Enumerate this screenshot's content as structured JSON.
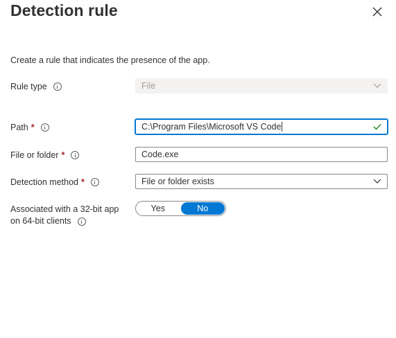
{
  "panel": {
    "title": "Detection rule",
    "description": "Create a rule that indicates the presence of the app."
  },
  "rule_type": {
    "label": "Rule type",
    "value": "File"
  },
  "path": {
    "label": "Path",
    "required_mark": "*",
    "value": "C:\\Program Files\\Microsoft VS Code"
  },
  "file_or_folder": {
    "label": "File or folder",
    "required_mark": "*",
    "value": "Code.exe"
  },
  "detection_method": {
    "label": "Detection method",
    "required_mark": "*",
    "value": "File or folder exists"
  },
  "associated_32bit": {
    "label_line1": "Associated with a 32-bit app",
    "label_line2": "on 64-bit clients",
    "options": [
      "Yes",
      "No"
    ],
    "selected": "No"
  },
  "colors": {
    "accent": "#0078d4",
    "required": "#a4262c",
    "valid_check": "#107c10",
    "disabled_bg": "#f3f2f1"
  }
}
